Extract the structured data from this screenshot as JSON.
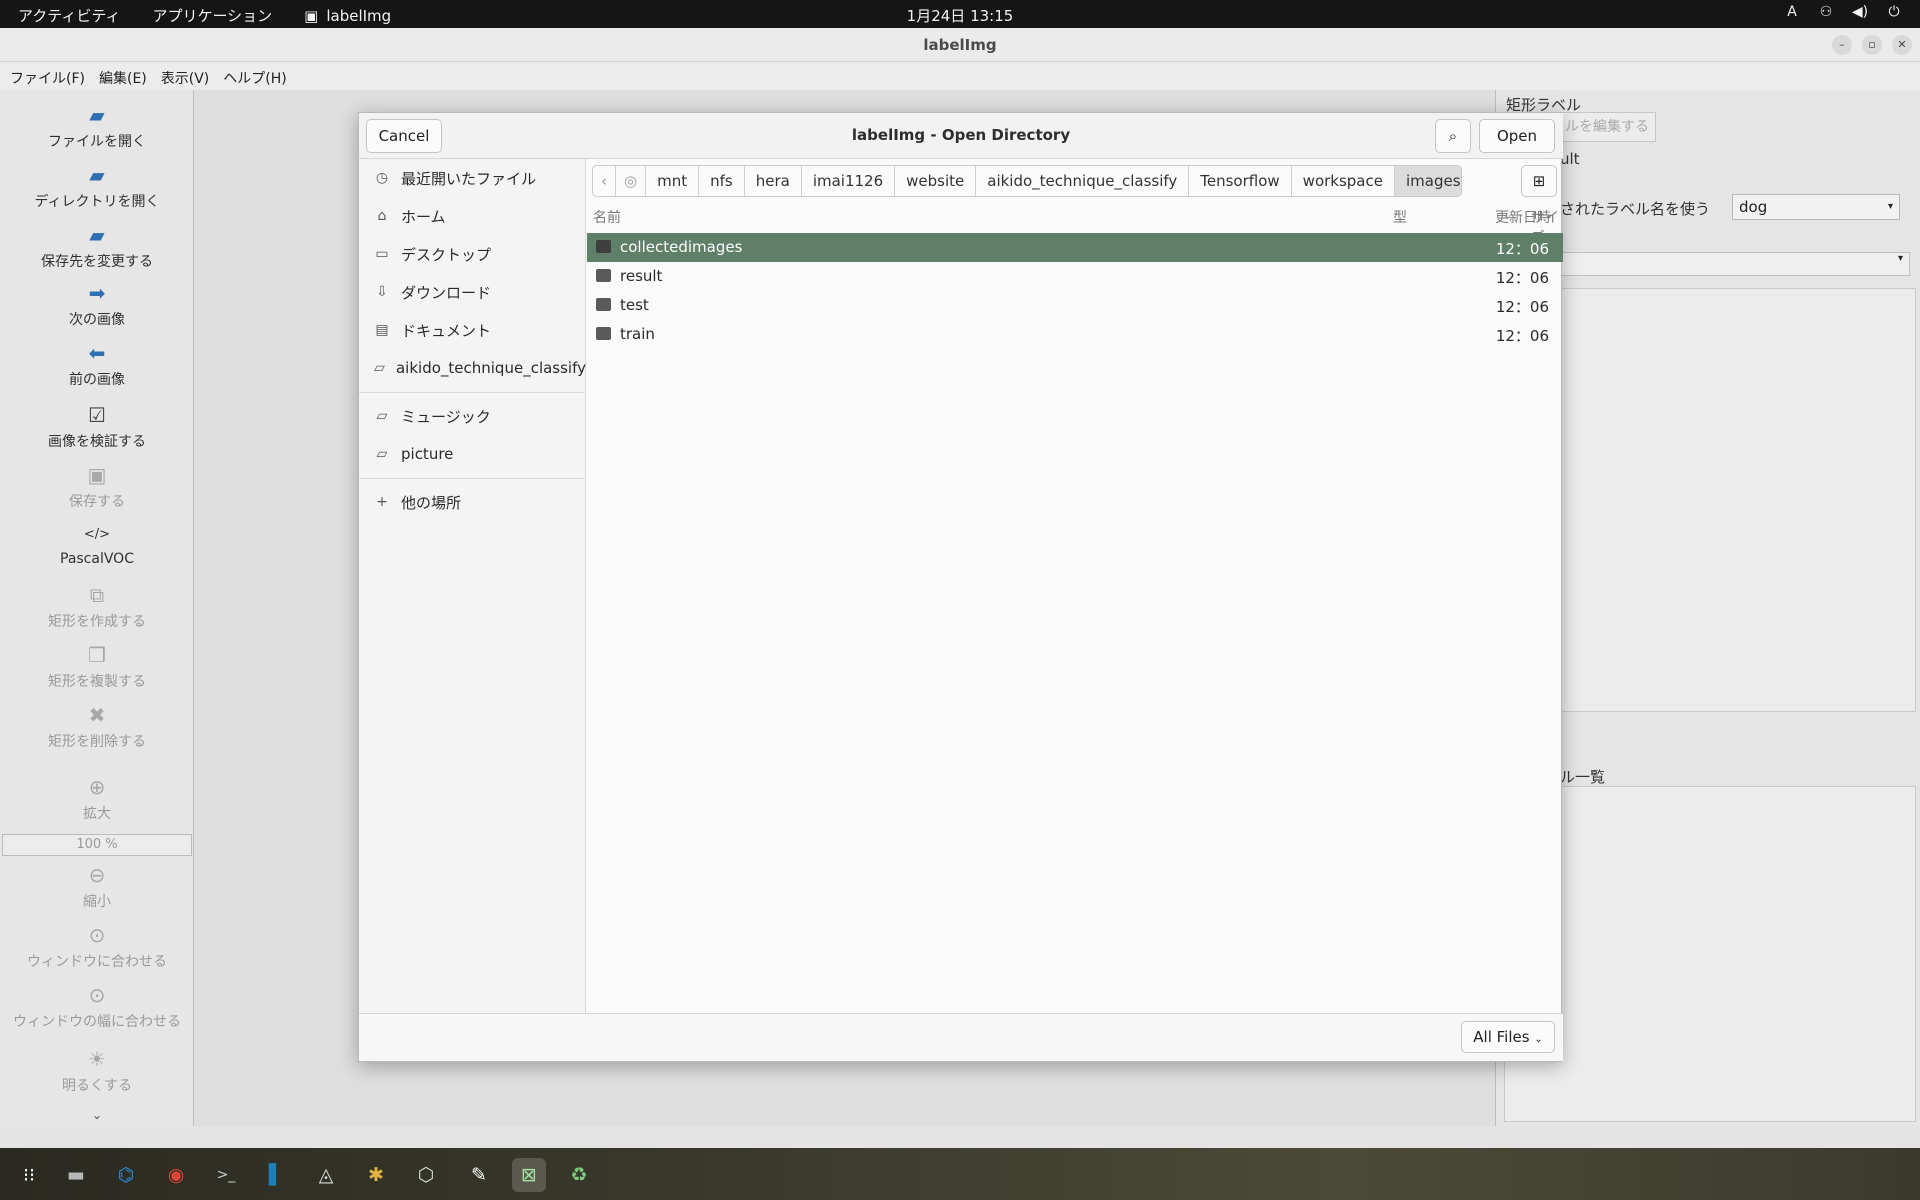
{
  "topbar": {
    "activities": "アクティビティ",
    "applications": "アプリケーション",
    "app_name": "labelImg",
    "clock": "1月24日  13:15",
    "input_method": "A"
  },
  "window": {
    "title": "labelImg",
    "controls": [
      "–",
      "▫",
      "✕"
    ]
  },
  "menubar": [
    "ファイル(F)",
    "編集(E)",
    "表示(V)",
    "ヘルプ(H)"
  ],
  "toolbar": {
    "open_file": "ファイルを開く",
    "open_dir": "ディレクトリを開く",
    "change_save_dir": "保存先を変更する",
    "next_image": "次の画像",
    "prev_image": "前の画像",
    "verify_image": "画像を検証する",
    "save": "保存する",
    "format": "PascalVOC",
    "create_rect": "矩形を作成する",
    "duplicate_rect": "矩形を複製する",
    "delete_rect": "矩形を削除する",
    "zoom_in": "拡大",
    "zoom_value": "100 %",
    "zoom_out": "縮小",
    "fit_window": "ウィンドウに合わせる",
    "fit_width": "ウィンドウの幅に合わせる",
    "brighten": "明るくする",
    "more": "⌄"
  },
  "right_dock": {
    "box_labels_title": "矩形ラベル",
    "edit_label_button": "ルを編集する",
    "difficult_partial": "ult",
    "use_default_label": "されたラベル名を使う",
    "default_label_value": "dog",
    "file_list_title": "ル一覧"
  },
  "dialog": {
    "title": "labelImg - Open Directory",
    "cancel": "Cancel",
    "open": "Open",
    "places": [
      {
        "icon": "recent-icon",
        "glyph": "◷",
        "label": "最近開いたファイル"
      },
      {
        "icon": "home-icon",
        "glyph": "⌂",
        "label": "ホーム"
      },
      {
        "icon": "desktop-icon",
        "glyph": "▭",
        "label": "デスクトップ"
      },
      {
        "icon": "download-icon",
        "glyph": "⇩",
        "label": "ダウンロード"
      },
      {
        "icon": "documents-icon",
        "glyph": "▤",
        "label": "ドキュメント"
      },
      {
        "icon": "folder-icon",
        "glyph": "▱",
        "label": "aikido_technique_classify"
      },
      {
        "icon": "folder-icon",
        "glyph": "▱",
        "label": "ミュージック"
      },
      {
        "icon": "folder-icon",
        "glyph": "▱",
        "label": "picture"
      },
      {
        "icon": "plus-icon",
        "glyph": "+",
        "label": "他の場所"
      }
    ],
    "path": [
      "mnt",
      "nfs",
      "hera",
      "imai1126",
      "website",
      "aikido_technique_classify",
      "Tensorflow",
      "workspace",
      "images"
    ],
    "columns": {
      "name": "名前",
      "size": "サイズ",
      "type": "型",
      "modified": "更新日時"
    },
    "files": [
      {
        "name": "collectedimages",
        "time": "12：06",
        "selected": true
      },
      {
        "name": "result",
        "time": "12：06",
        "selected": false
      },
      {
        "name": "test",
        "time": "12：06",
        "selected": false
      },
      {
        "name": "train",
        "time": "12：06",
        "selected": false
      }
    ],
    "filter": "All Files"
  },
  "taskbar": [
    {
      "icon": "app-grid-icon",
      "glyph": "⁝⁝",
      "color": "#ffffff"
    },
    {
      "icon": "files-icon",
      "glyph": "▬",
      "color": "#b8b8b8"
    },
    {
      "icon": "vscode-icon",
      "glyph": "⌬",
      "color": "#2f8ee0"
    },
    {
      "icon": "chrome-icon",
      "glyph": "◉",
      "color": "#e0453a"
    },
    {
      "icon": "terminal-icon",
      "glyph": ">_",
      "color": "#cfcfcf"
    },
    {
      "icon": "pycharm-icon",
      "glyph": "▌",
      "color": "#1e7fb8"
    },
    {
      "icon": "update-icon",
      "glyph": "◬",
      "color": "#dddddd"
    },
    {
      "icon": "slack-icon",
      "glyph": "✱",
      "color": "#e3b341"
    },
    {
      "icon": "unity-icon",
      "glyph": "⬡",
      "color": "#dddddd"
    },
    {
      "icon": "text-editor-icon",
      "glyph": "✎",
      "color": "#ffffff"
    },
    {
      "icon": "labelimg-icon",
      "glyph": "⊠",
      "color": "#9ee39e"
    },
    {
      "icon": "trash-icon",
      "glyph": "♻",
      "color": "#7ccf7c"
    }
  ]
}
